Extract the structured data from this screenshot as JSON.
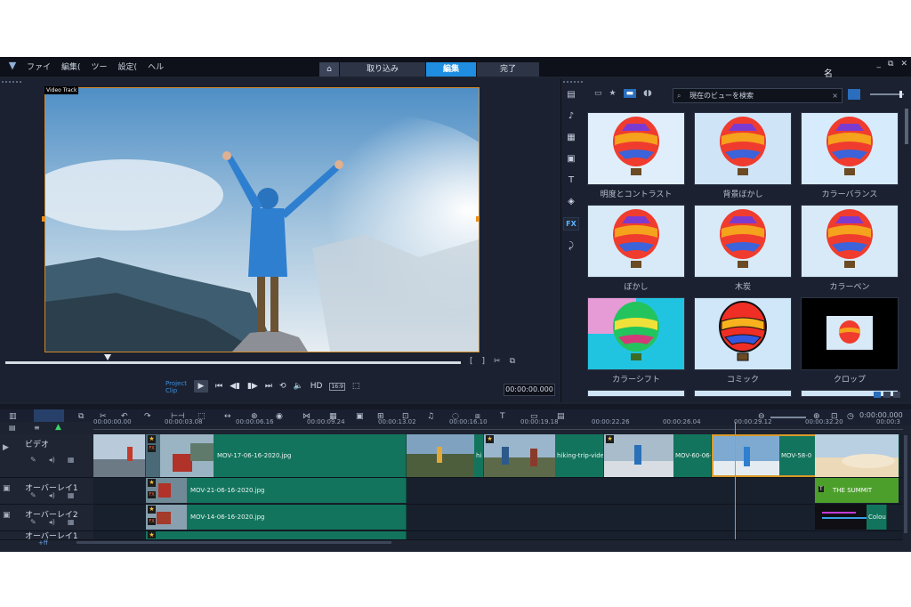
{
  "app": {
    "menu": [
      "ファイ",
      "編集(",
      "ツー",
      "設定(",
      "ヘル"
    ],
    "tabs": [
      {
        "label": "取り込み"
      },
      {
        "label": "編集",
        "active": true
      },
      {
        "label": "完了"
      }
    ],
    "user_name": "名",
    "window_buttons": [
      "_",
      "⧉",
      "✕"
    ]
  },
  "preview": {
    "track_badge": "Video Track",
    "project_label": "Project",
    "clip_label": "Clip",
    "hd_label": "HD",
    "aspect_label": "16:9",
    "timecode": "00:00:00.000"
  },
  "library": {
    "search_placeholder": "現在のビューを検索",
    "effects": [
      {
        "name": "明度とコントラスト"
      },
      {
        "name": "背景ぼかし"
      },
      {
        "name": "カラーバランス"
      },
      {
        "name": "ぼかし"
      },
      {
        "name": "木炭"
      },
      {
        "name": "カラーペン"
      },
      {
        "name": "カラーシフト"
      },
      {
        "name": "コミック"
      },
      {
        "name": "クロップ"
      }
    ],
    "fx_tab": "FX"
  },
  "timeline": {
    "timecode": "0:00:00.000",
    "ruler": [
      "00:00:00.00",
      "00:00:03.08",
      "00:00:06.16",
      "00:00:09.24",
      "00:00:13.02",
      "00:00:16.10",
      "00:00:19.18",
      "00:00:22.26",
      "00:00:26.04",
      "00:00:29.12",
      "00:00:32.20",
      "00:00:3"
    ],
    "tracks": [
      {
        "name": "ビデオ"
      },
      {
        "name": "オーバーレイ1"
      },
      {
        "name": "オーバーレイ2"
      },
      {
        "name": "オーバーレイ1"
      }
    ],
    "clips": {
      "video_main": "MOV-17-06-16-2020.jpg",
      "video_hik": "hi",
      "video_trip": "hiking-trip-video",
      "video_mov60": "MOV-60-06-",
      "video_mov58": "MOV-58-0",
      "overlay1": "MOV-21-06-16-2020.jpg",
      "overlay2": "MOV-14-06-16-2020.jpg",
      "title": "THE SUMMIT",
      "colour": "Colou"
    },
    "zoom_label": "+ff"
  },
  "colors": {
    "accent": "#1f8ee0",
    "clip_green": "#13745d",
    "title_green": "#4d9f2c",
    "playhead": "#5ba8ff"
  }
}
